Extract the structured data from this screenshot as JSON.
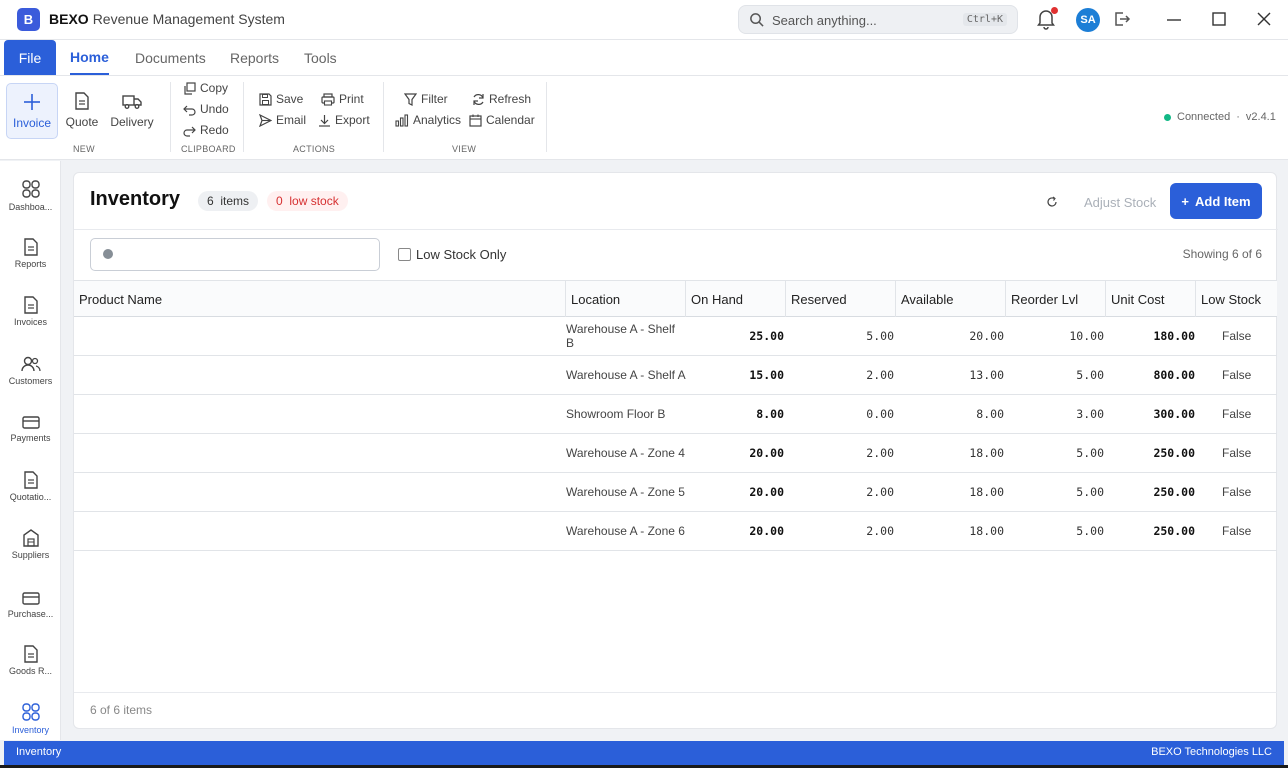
{
  "app": {
    "logo_letter": "B",
    "brand": "BEXO",
    "title": "Revenue Management System"
  },
  "search": {
    "placeholder": "Search anything...",
    "shortcut": "Ctrl+K"
  },
  "user": {
    "initials": "SA"
  },
  "menu": {
    "file": "File",
    "tabs": [
      "Home",
      "Documents",
      "Reports",
      "Tools"
    ]
  },
  "ribbon": {
    "new": {
      "label": "NEW",
      "invoice": "Invoice",
      "quote": "Quote",
      "delivery": "Delivery"
    },
    "clipboard": {
      "label": "CLIPBOARD",
      "copy": "Copy",
      "undo": "Undo",
      "redo": "Redo"
    },
    "actions": {
      "label": "ACTIONS",
      "save": "Save",
      "print": "Print",
      "email": "Email",
      "export": "Export"
    },
    "view": {
      "label": "VIEW",
      "filter": "Filter",
      "refresh": "Refresh",
      "analytics": "Analytics",
      "calendar": "Calendar"
    },
    "status": {
      "connected": "Connected",
      "sep": "·",
      "version": "v2.4.1"
    }
  },
  "sidebar": {
    "items": [
      "Dashboa...",
      "Reports",
      "Invoices",
      "Customers",
      "Payments",
      "Quotatio...",
      "Suppliers",
      "Purchase...",
      "Goods R...",
      "Inventory"
    ]
  },
  "page": {
    "title": "Inventory",
    "items_badge_count": "6",
    "items_badge_text": "items",
    "low_badge_count": "0",
    "low_badge_text": "low stock",
    "adjust_label": "Adjust Stock",
    "add_label": "Add Item",
    "low_stock_only": "Low Stock Only",
    "showing": "Showing  6  of  6",
    "footer": "6  of  6  items"
  },
  "table": {
    "columns": [
      "Product Name",
      "Location",
      "On Hand",
      "Reserved",
      "Available",
      "Reorder Lvl",
      "Unit Cost",
      "Low Stock"
    ],
    "rows": [
      {
        "name": "",
        "location": "Warehouse A - Shelf B",
        "on_hand": "25.00",
        "reserved": "5.00",
        "available": "20.00",
        "reorder": "10.00",
        "unit_cost": "180.00",
        "low": "False"
      },
      {
        "name": "",
        "location": "Warehouse A - Shelf A",
        "on_hand": "15.00",
        "reserved": "2.00",
        "available": "13.00",
        "reorder": "5.00",
        "unit_cost": "800.00",
        "low": "False"
      },
      {
        "name": "",
        "location": "Showroom Floor B",
        "on_hand": "8.00",
        "reserved": "0.00",
        "available": "8.00",
        "reorder": "3.00",
        "unit_cost": "300.00",
        "low": "False"
      },
      {
        "name": "",
        "location": "Warehouse A - Zone 4",
        "on_hand": "20.00",
        "reserved": "2.00",
        "available": "18.00",
        "reorder": "5.00",
        "unit_cost": "250.00",
        "low": "False"
      },
      {
        "name": "",
        "location": "Warehouse A - Zone 5",
        "on_hand": "20.00",
        "reserved": "2.00",
        "available": "18.00",
        "reorder": "5.00",
        "unit_cost": "250.00",
        "low": "False"
      },
      {
        "name": "",
        "location": "Warehouse A - Zone 6",
        "on_hand": "20.00",
        "reserved": "2.00",
        "available": "18.00",
        "reorder": "5.00",
        "unit_cost": "250.00",
        "low": "False"
      }
    ]
  },
  "statusbar": {
    "left": "Inventory",
    "right": "BEXO Technologies LLC"
  },
  "colors": {
    "accent": "#2b5fd9",
    "danger": "#d63031",
    "connected": "#12b886"
  }
}
